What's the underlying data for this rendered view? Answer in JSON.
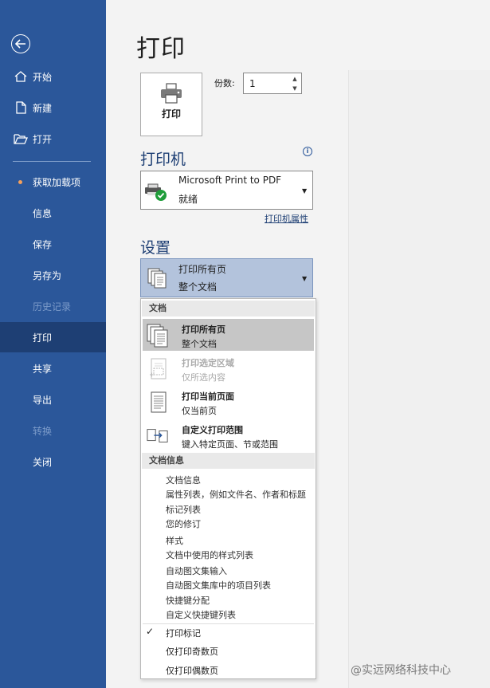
{
  "sidebar": {
    "items": [
      {
        "label": "开始"
      },
      {
        "label": "新建"
      },
      {
        "label": "打开"
      },
      {
        "label": "获取加载项"
      },
      {
        "label": "信息"
      },
      {
        "label": "保存"
      },
      {
        "label": "另存为"
      },
      {
        "label": "历史记录"
      },
      {
        "label": "打印"
      },
      {
        "label": "共享"
      },
      {
        "label": "导出"
      },
      {
        "label": "转换"
      },
      {
        "label": "关闭"
      }
    ]
  },
  "main": {
    "title": "打印",
    "print_button": "打印",
    "copies": {
      "label": "份数:",
      "value": "1"
    },
    "printer": {
      "section_title": "打印机",
      "name": "Microsoft Print to PDF",
      "status": "就绪",
      "properties_link": "打印机属性"
    },
    "settings": {
      "section_title": "设置",
      "selected_title": "打印所有页",
      "selected_sub": "整个文档"
    }
  },
  "dropdown": {
    "header_document": "文档",
    "items": [
      {
        "title": "打印所有页",
        "sub": "整个文档"
      },
      {
        "title": "打印选定区域",
        "sub": "仅所选内容"
      },
      {
        "title": "打印当前页面",
        "sub": "仅当前页"
      },
      {
        "title": "自定义打印范围",
        "sub": "键入特定页面、节或范围"
      }
    ],
    "header_info": "文档信息",
    "info_lines": [
      "文档信息",
      "属性列表，例如文件名、作者和标题",
      "标记列表",
      "您的修订",
      "样式",
      "文档中使用的样式列表",
      "自动图文集输入",
      "自动图文集库中的项目列表",
      "快捷键分配",
      "自定义快捷键列表"
    ],
    "options": [
      "打印标记",
      "仅打印奇数页",
      "仅打印偶数页"
    ]
  },
  "watermark": "@实远网络科技中心",
  "colors": {
    "sidebar": "#2b579a",
    "active": "#1e3f74",
    "selection": "#b3c3dc"
  }
}
